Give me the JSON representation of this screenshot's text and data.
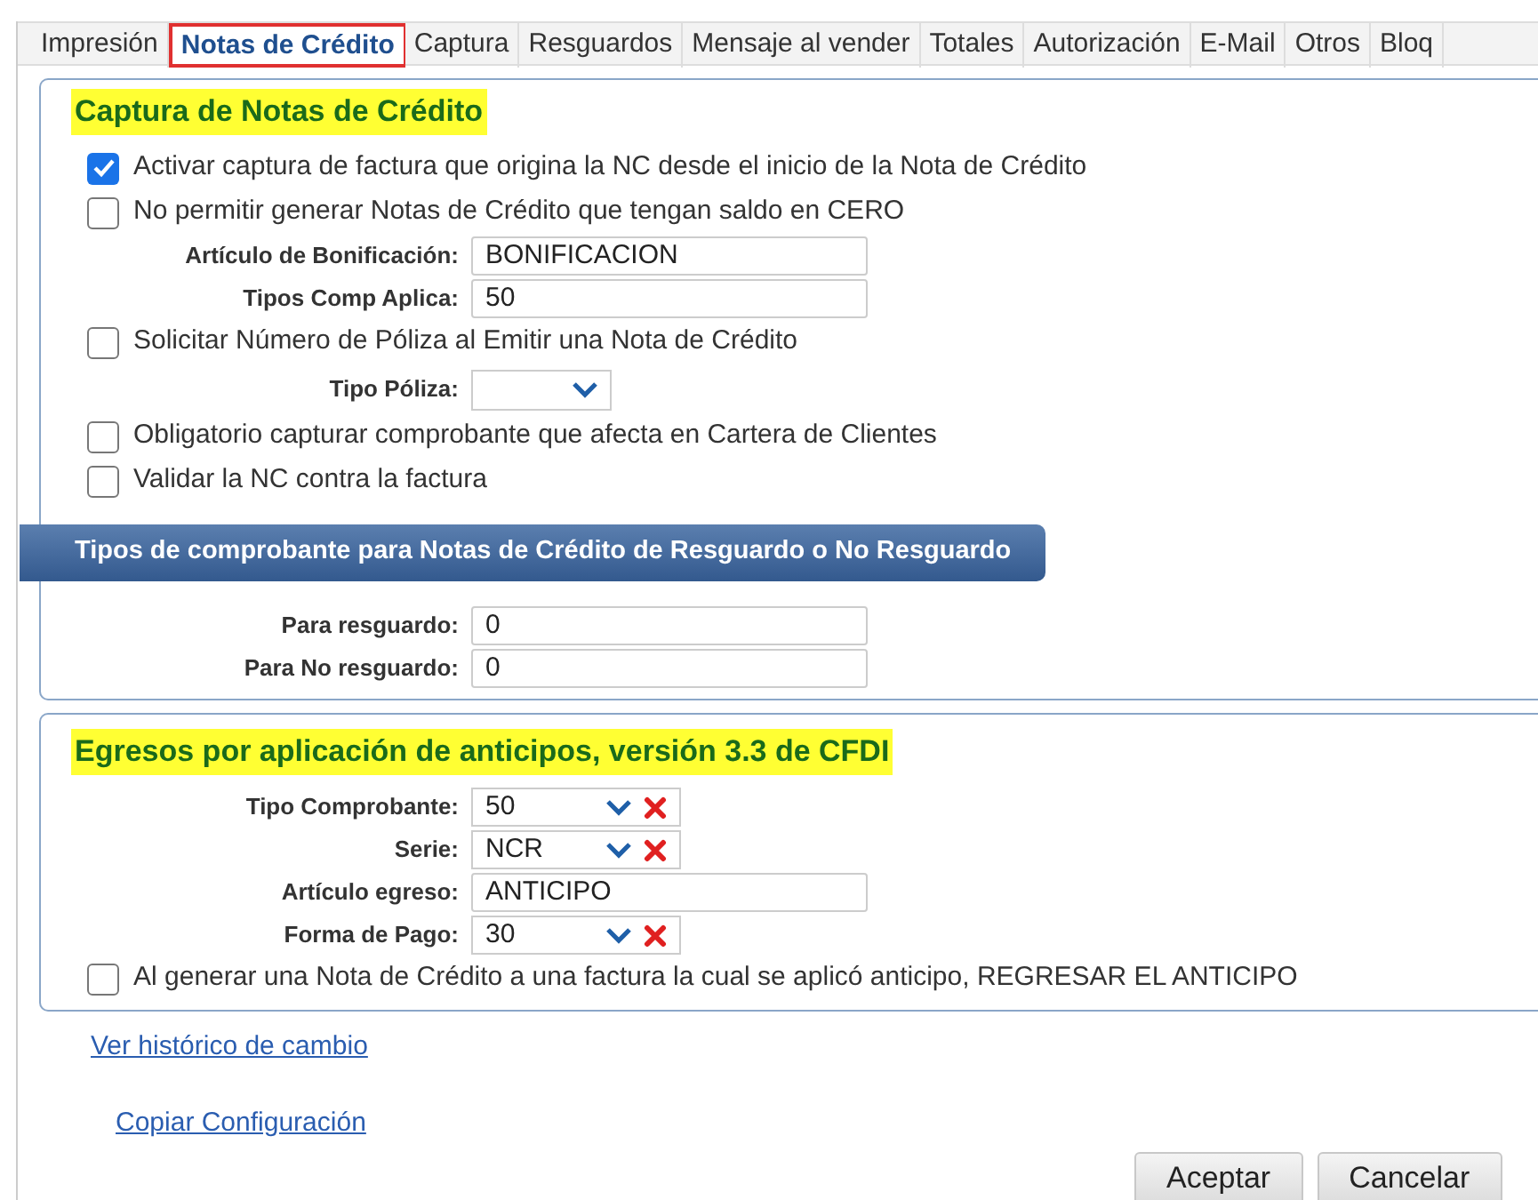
{
  "tabs": [
    {
      "label": "Impresión",
      "selected": false
    },
    {
      "label": "Notas de Crédito",
      "selected": true
    },
    {
      "label": "Captura",
      "selected": false
    },
    {
      "label": "Resguardos",
      "selected": false
    },
    {
      "label": "Mensaje al vender",
      "selected": false
    },
    {
      "label": "Totales",
      "selected": false
    },
    {
      "label": "Autorización",
      "selected": false
    },
    {
      "label": "E-Mail",
      "selected": false
    },
    {
      "label": "Otros",
      "selected": false
    },
    {
      "label": "Bloq",
      "selected": false
    }
  ],
  "section_1": {
    "title": "Captura de Notas de Crédito",
    "items": [
      {
        "kind": "checkbox",
        "label": "Activar captura de factura que origina la NC desde el inicio de la Nota de Crédito",
        "checked": true
      },
      {
        "kind": "checkbox",
        "label": "No permitir generar Notas de Crédito que tengan saldo en CERO",
        "checked": false
      },
      {
        "kind": "field",
        "label": "Artículo de Bonificación:",
        "value": "BONIFICACION"
      },
      {
        "kind": "field",
        "label": "Tipos Comp Aplica:",
        "value": "50"
      },
      {
        "kind": "checkbox",
        "label": "Solicitar Número de Póliza al Emitir una Nota de Crédito",
        "checked": false
      },
      {
        "kind": "select",
        "label": "Tipo Póliza:"
      },
      {
        "kind": "checkbox",
        "label": "Obligatorio capturar comprobante que afecta en Cartera de Clientes",
        "checked": false
      },
      {
        "kind": "checkbox",
        "label": "Validar la NC contra la factura",
        "checked": false
      }
    ],
    "ribbon": "Tipos de comprobante para Notas de Crédito de Resguardo o No Resguardo",
    "fields": [
      {
        "label": "Para resguardo:",
        "value": "0"
      },
      {
        "label": "Para No resguardo:",
        "value": "0"
      }
    ]
  },
  "section_2": {
    "title": "Egresos por aplicación de anticipos, versión 3.3 de CFDI",
    "items": [
      {
        "kind": "combo",
        "label": "Tipo Comprobante:",
        "value": "50"
      },
      {
        "kind": "combo",
        "label": "Serie:",
        "value": "NCR"
      },
      {
        "kind": "field",
        "label": "Artículo egreso:",
        "value": "ANTICIPO"
      },
      {
        "kind": "combo",
        "label": "Forma de Pago:",
        "value": "30"
      },
      {
        "kind": "checkbox",
        "label": "Al generar una Nota de Crédito a una factura la cual se aplicó anticipo, REGRESAR EL ANTICIPO",
        "checked": false
      }
    ]
  },
  "links": [
    "Ver histórico de cambio",
    "Copiar Configuración"
  ],
  "buttons": [
    "Aceptar",
    "Cancelar"
  ]
}
